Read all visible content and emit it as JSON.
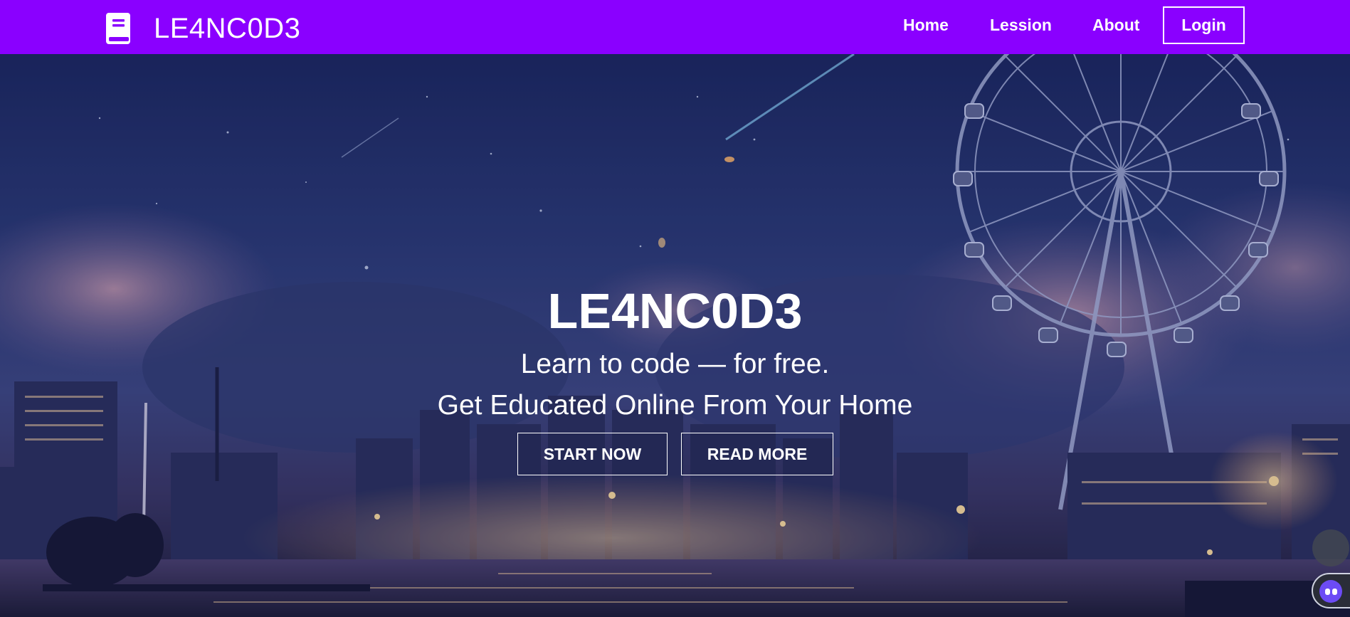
{
  "navbar": {
    "brand": {
      "icon": "book-icon",
      "name": "LE4NC0D3"
    },
    "links": [
      {
        "label": "Home"
      },
      {
        "label": "Lession"
      },
      {
        "label": "About"
      }
    ],
    "login_label": "Login",
    "background_color": "#8a00ff"
  },
  "hero": {
    "background": "night-city-ferris-wheel-illustration",
    "title": "LE4NC0D3",
    "subtitle_line1": "Learn to code — for free.",
    "subtitle_line2": "Get Educated Online From Your Home",
    "buttons": {
      "start_label": "START NOW",
      "read_label": "READ MORE"
    }
  },
  "widgets": {
    "floating_button_icon": "scroll-circle-icon",
    "chat_icon": "chat-assistant-icon"
  }
}
